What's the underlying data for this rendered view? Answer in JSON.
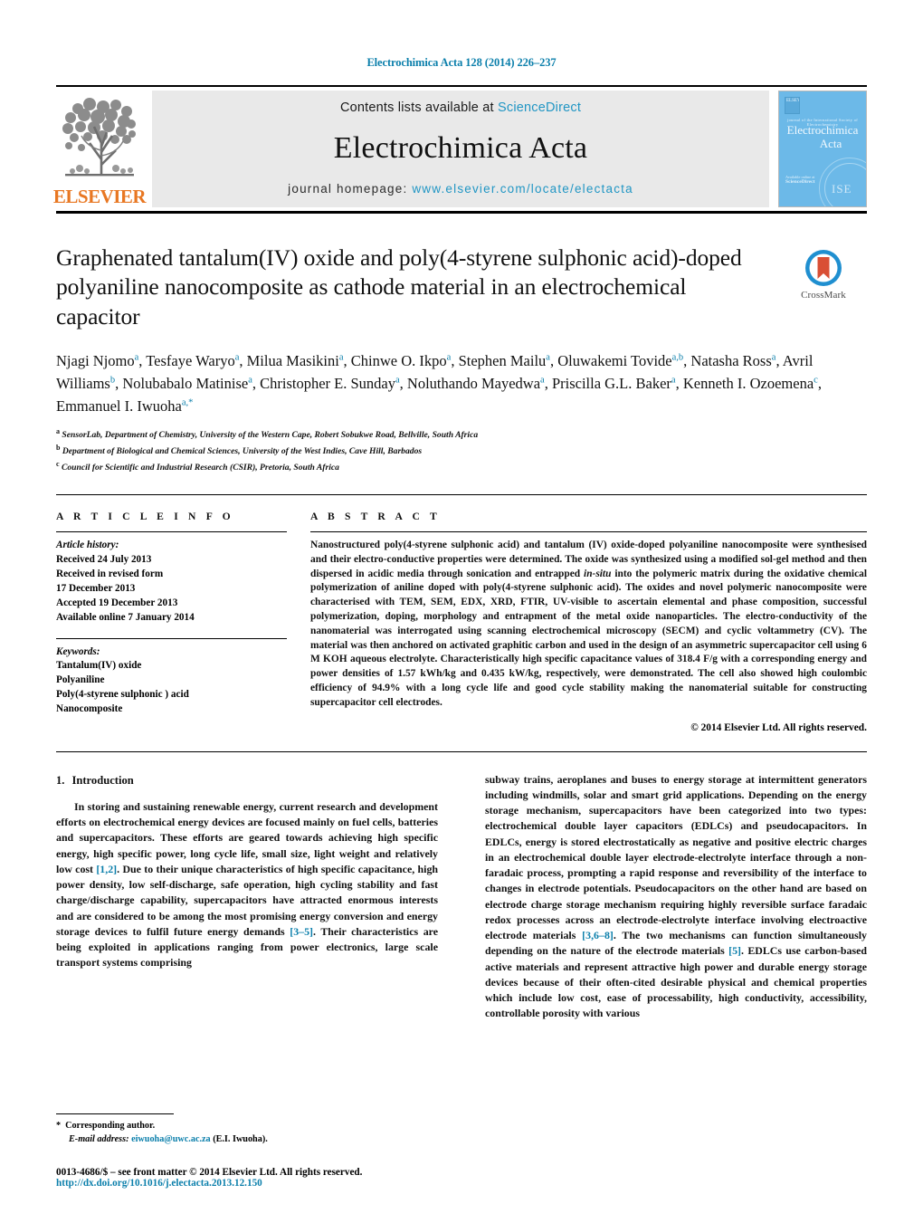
{
  "running_head": "Electrochimica Acta 128 (2014) 226–237",
  "masthead": {
    "publisher_logo_text": "ELSEVIER",
    "contents_prefix": "Contents lists available at ",
    "contents_link": "ScienceDirect",
    "journal_title": "Electrochimica Acta",
    "homepage_prefix": "journal homepage: ",
    "homepage_url": "www.elsevier.com/locate/electacta",
    "cover": {
      "imprint_mark": "ELSEVIER",
      "subtitle": "journal of the International Society of Electrochemistry",
      "title_line1": "Electrochimica",
      "title_line2": "Acta",
      "footer_small": "Available online at",
      "footer_brand": "ScienceDirect",
      "seal_text": "ISE"
    },
    "accent_link_color": "#2196c4",
    "elsevier_orange": "#e87722"
  },
  "article": {
    "title": "Graphenated tantalum(IV) oxide and poly(4-styrene sulphonic acid)-doped polyaniline nanocomposite as cathode material in an electrochemical capacitor",
    "crossmark_label": "CrossMark",
    "authors_html": "Njagi Njomo<sup>a</sup>, Tesfaye Waryo<sup>a</sup>, Milua Masikini<sup>a</sup>, Chinwe O. Ikpo<sup>a</sup>, Stephen Mailu<sup>a</sup>, Oluwakemi Tovide<sup>a,b</sup>, Natasha Ross<sup>a</sup>, Avril Williams<sup>b</sup>, Nolubabalo Matinise<sup>a</sup>, Christopher E. Sunday<sup>a</sup>, Noluthando Mayedwa<sup>a</sup>, Priscilla G.L. Baker<sup>a</sup>, Kenneth I. Ozoemena<sup>c</sup>, Emmanuel I. Iwuoha<sup>a,*</sup>",
    "affiliations": [
      {
        "mark": "a",
        "text": "SensorLab, Department of Chemistry, University of the Western Cape, Robert Sobukwe Road, Bellville, South Africa"
      },
      {
        "mark": "b",
        "text": "Department of Biological and Chemical Sciences, University of the West Indies, Cave Hill, Barbados"
      },
      {
        "mark": "c",
        "text": "Council for Scientific and Industrial Research (CSIR), Pretoria, South Africa"
      }
    ]
  },
  "article_info": {
    "heading": "A R T I C L E  I N F O",
    "history_label": "Article history:",
    "history_lines": [
      "Received 24 July 2013",
      "Received in revised form",
      "17 December 2013",
      "Accepted 19 December 2013",
      "Available online 7 January 2014"
    ],
    "keywords_label": "Keywords:",
    "keywords": [
      "Tantalum(IV) oxide",
      "Polyaniline",
      "Poly(4-styrene sulphonic ) acid",
      "Nanocomposite"
    ]
  },
  "abstract": {
    "heading": "A B S T R A C T",
    "text_html": "Nanostructured poly(4-styrene sulphonic acid) and tantalum (IV) oxide-doped polyaniline nanocomposite were synthesised and their electro-conductive properties were determined. The oxide was synthesized using a modified sol-gel method and then dispersed in acidic media through sonication and entrapped <i>in-situ</i> into the polymeric matrix during the oxidative chemical polymerization of aniline doped with poly(4-styrene sulphonic acid). The oxides and novel polymeric nanocomposite were characterised with TEM, SEM, EDX, XRD, FTIR, UV-visible to ascertain elemental and phase composition, successful polymerization, doping, morphology and entrapment of the metal oxide nanoparticles. The electro-conductivity of the nanomaterial was interrogated using scanning electrochemical microscopy (SECM) and cyclic voltammetry (CV). The material was then anchored on activated graphitic carbon and used in the design of an asymmetric supercapacitor cell using 6 M KOH aqueous electrolyte. Characteristically high specific capacitance values of 318.4 F/g with a corresponding energy and power densities of 1.57 kWh/kg and 0.435 kW/kg, respectively, were demonstrated. The cell also showed high coulombic efficiency of 94.9% with a long cycle life and good cycle stability making the nanomaterial suitable for constructing supercapacitor cell electrodes.",
    "copyright": "© 2014 Elsevier Ltd. All rights reserved."
  },
  "introduction": {
    "number": "1.",
    "heading": "Introduction",
    "left_column_html": "In storing and sustaining renewable energy, current research and development efforts on electrochemical energy devices are focused mainly on fuel cells, batteries and supercapacitors. These efforts are geared towards achieving high specific energy, high specific power, long cycle life, small size, light weight and relatively low cost <span class=\"ref\">[1,2]</span>. Due to their unique characteristics of high specific capacitance, high power density, low self-discharge, safe operation, high cycling stability and fast charge/discharge capability, supercapacitors have attracted enormous interests and are considered to be among the most promising energy conversion and energy storage devices to fulfil future energy demands <span class=\"ref\">[3–5]</span>. Their characteristics are being exploited in applications ranging from power electronics, large scale transport systems comprising",
    "right_column_html": "subway trains, aeroplanes and buses to energy storage at intermittent generators including windmills, solar and smart grid applications. Depending on the energy storage mechanism, supercapacitors have been categorized into two types: electrochemical double layer capacitors (EDLCs) and pseudocapacitors. In EDLCs, energy is stored electrostatically as negative and positive electric charges in an electrochemical double layer electrode-electrolyte interface through a non-faradaic process, prompting a rapid response and reversibility of the interface to changes in electrode potentials. Pseudocapacitors on the other hand are based on electrode charge storage mechanism requiring highly reversible surface faradaic redox processes across an electrode-electrolyte interface involving electroactive electrode materials <span class=\"ref\">[3,6–8]</span>. The two mechanisms can function simultaneously depending on the nature of the electrode materials <span class=\"ref\">[5]</span>. EDLCs use carbon-based active materials and represent attractive high power and durable energy storage devices because of their often-cited desirable physical and chemical properties which include low cost, ease of processability, high conductivity, accessibility, controllable porosity with various"
  },
  "footer": {
    "corresponding_marker": "*",
    "corresponding_label": "Corresponding author.",
    "email_label": "E-mail address:",
    "email": "eiwuoha@uwc.ac.za",
    "email_suffix": "(E.I. Iwuoha).",
    "issn_line": "0013-4686/$ – see front matter © 2014 Elsevier Ltd. All rights reserved.",
    "doi": "http://dx.doi.org/10.1016/j.electacta.2013.12.150"
  }
}
